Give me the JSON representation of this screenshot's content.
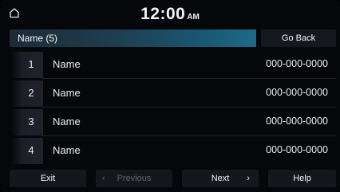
{
  "status": {
    "time": "12:00",
    "ampm": "AM",
    "home_icon": "home-icon"
  },
  "header": {
    "title": "Name (5)",
    "go_back_label": "Go Back"
  },
  "list": [
    {
      "index": "1",
      "name": "Name",
      "phone": "000-000-0000"
    },
    {
      "index": "2",
      "name": "Name",
      "phone": "000-000-0000"
    },
    {
      "index": "3",
      "name": "Name",
      "phone": "000-000-0000"
    },
    {
      "index": "4",
      "name": "Name",
      "phone": "000-000-0000"
    }
  ],
  "footer": {
    "exit_label": "Exit",
    "previous_label": "Previous",
    "previous_icon": "chevron-left-icon",
    "next_label": "Next",
    "next_icon": "chevron-right-icon",
    "help_label": "Help"
  },
  "colors": {
    "background": "#05070a",
    "title_gradient_end": "#1c6a88",
    "button": "#14171c",
    "disabled_text": "#5c636c"
  }
}
